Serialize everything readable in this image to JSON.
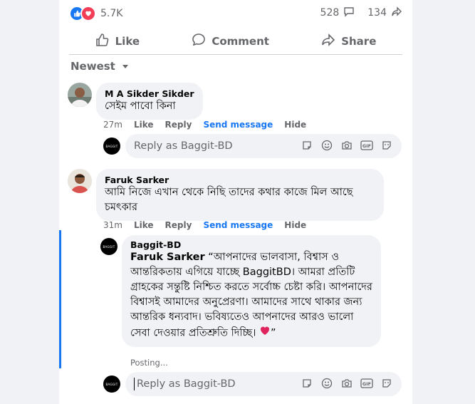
{
  "post": {
    "reaction_count": "5.7K",
    "comments_count": "528",
    "shares_count": "134"
  },
  "actions": {
    "like": "Like",
    "comment": "Comment",
    "share": "Share"
  },
  "sort_label": "Newest",
  "comments": [
    {
      "author": "M A Sikder Sikder",
      "text": "সেইম পাবো কিনা",
      "time": "27m",
      "like": "Like",
      "reply": "Reply",
      "send_message": "Send message",
      "hide": "Hide"
    },
    {
      "author": "Faruk Sarker",
      "text": "আমি নিজে এখান থেকে নিছি তাদের কথার কাজে মিল আছে চমৎকার",
      "time": "31m",
      "like": "Like",
      "reply": "Reply",
      "send_message": "Send message",
      "hide": "Hide"
    }
  ],
  "page_reply": {
    "author": "Baggit-BD",
    "mention": "Faruk Sarker",
    "text": " “আপনাদের ভালবাসা, বিশ্বাস ও আন্তরিকতায় এগিয়ে যাচ্ছে BaggitBD। আমরা প্রতিটি গ্রাহকের সন্তুষ্টি নিশ্চিত করতে সর্বোচ্চ চেষ্টা করি। আপনাদের বিশ্বাসই আমাদের অনুপ্রেরণা। আমাদের সাথে থাকার জন্য আন্তরিক ধন্যবাদ। ভবিষ্যতেও আপনাদের আরও ভালো সেবা দেওয়ার প্রতিশ্রুতি দিচ্ছি। ",
    "end_quote": "”",
    "status": "Posting...",
    "avatar_text": "BAGGIT"
  },
  "reply_input": {
    "placeholder": "Reply as Baggit-BD"
  },
  "colors": {
    "accent": "#1877f2",
    "love": "#f33e58",
    "bubble": "#f0f2f5"
  }
}
